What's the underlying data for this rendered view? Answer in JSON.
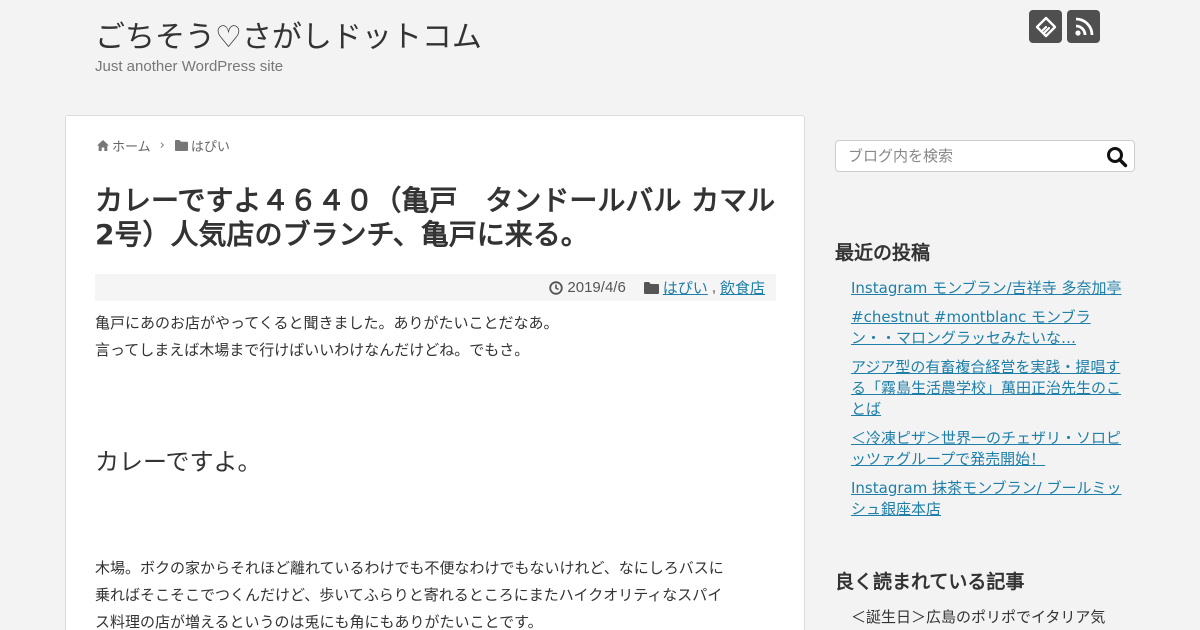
{
  "header": {
    "site_title": "ごちそう♡さがしドットコム",
    "site_description": "Just another WordPress site",
    "icons": [
      "feedly-icon",
      "rss-icon"
    ]
  },
  "breadcrumb": {
    "home": "ホーム",
    "category": "はぴい"
  },
  "post": {
    "title": "カレーですよ４６４０（亀戸　タンドールバル カマル2号）人気店のブランチ、亀戸に来る。",
    "date": "2019/4/6",
    "category_1": "はぴい",
    "category_separator": ",",
    "category_2": "飲食店",
    "para1_line1": "亀戸にあのお店がやってくると聞きました。ありがたいことだなあ。",
    "para1_line2": "言ってしまえば木場まで行けばいいわけなんだけどね。でもさ。",
    "heading": "カレーですよ。",
    "para2_line1": "木場。ボクの家からそれほど離れているわけでも不便なわけでもないけれど、なにしろバスに",
    "para2_line2": "乗ればそこそこでつくんだけど、歩いてふらりと寄れるところにまたハイクオリティなスパイ",
    "para2_line3": "ス料理の店が増えるというのは兎にも角にもありがたいことです。"
  },
  "sidebar": {
    "search_placeholder": "ブログ内を検索",
    "recent_title": "最近の投稿",
    "recent_posts": [
      "Instagram モンブラン/吉祥寺 多奈加亭",
      "#chestnut #montblanc モンブラン・・マロングラッセみたいな…",
      "アジア型の有畜複合経営を実践・提唱する「霧島生活農学校」萬田正治先生のことば",
      "＜冷凍ピザ＞世界一のチェザリ・ソロピッツァグループで発売開始！",
      "Instagram 抹茶モンブラン/ ブールミッシュ銀座本店"
    ],
    "popular_title": "良く読まれている記事",
    "popular_posts": [
      "＜誕生日＞広島のポリポでイタリア気"
    ]
  },
  "colors": {
    "background": "#f3f3f3",
    "link": "#1e7fa8",
    "icon_bg": "#4f4f4f"
  }
}
